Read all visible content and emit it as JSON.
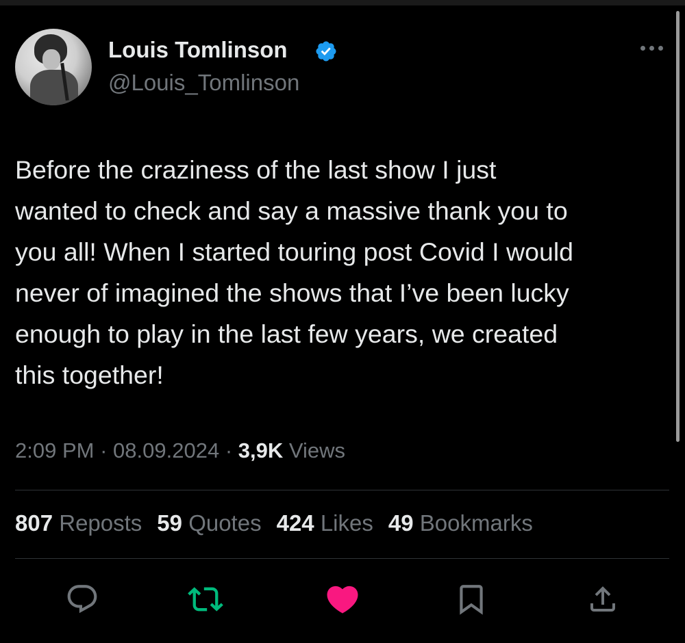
{
  "user": {
    "display_name": "Louis Tomlinson",
    "handle": "@Louis_Tomlinson",
    "verified_color": "#1d9bf0"
  },
  "tweet": {
    "text": "Before the craziness of the last show I just\nwanted to check and say a massive thank you to\nyou all! When I started touring post Covid I would\nnever of imagined the shows that I’ve been lucky\nenough to play in the last few years, we created\nthis together!",
    "time": "2:09 PM",
    "date": "08.09.2024",
    "views_count": "3,9K",
    "views_label": "Views"
  },
  "stats": [
    {
      "count": "807",
      "label": "Reposts"
    },
    {
      "count": "59",
      "label": "Quotes"
    },
    {
      "count": "424",
      "label": "Likes"
    },
    {
      "count": "49",
      "label": "Bookmarks"
    }
  ],
  "actions": {
    "reply_icon": "reply-icon",
    "repost_icon": "repost-icon",
    "like_icon": "heart-icon",
    "bookmark_icon": "bookmark-icon",
    "share_icon": "share-icon",
    "repost_color": "#00ba7c",
    "like_color": "#f91880"
  },
  "separator": "·"
}
